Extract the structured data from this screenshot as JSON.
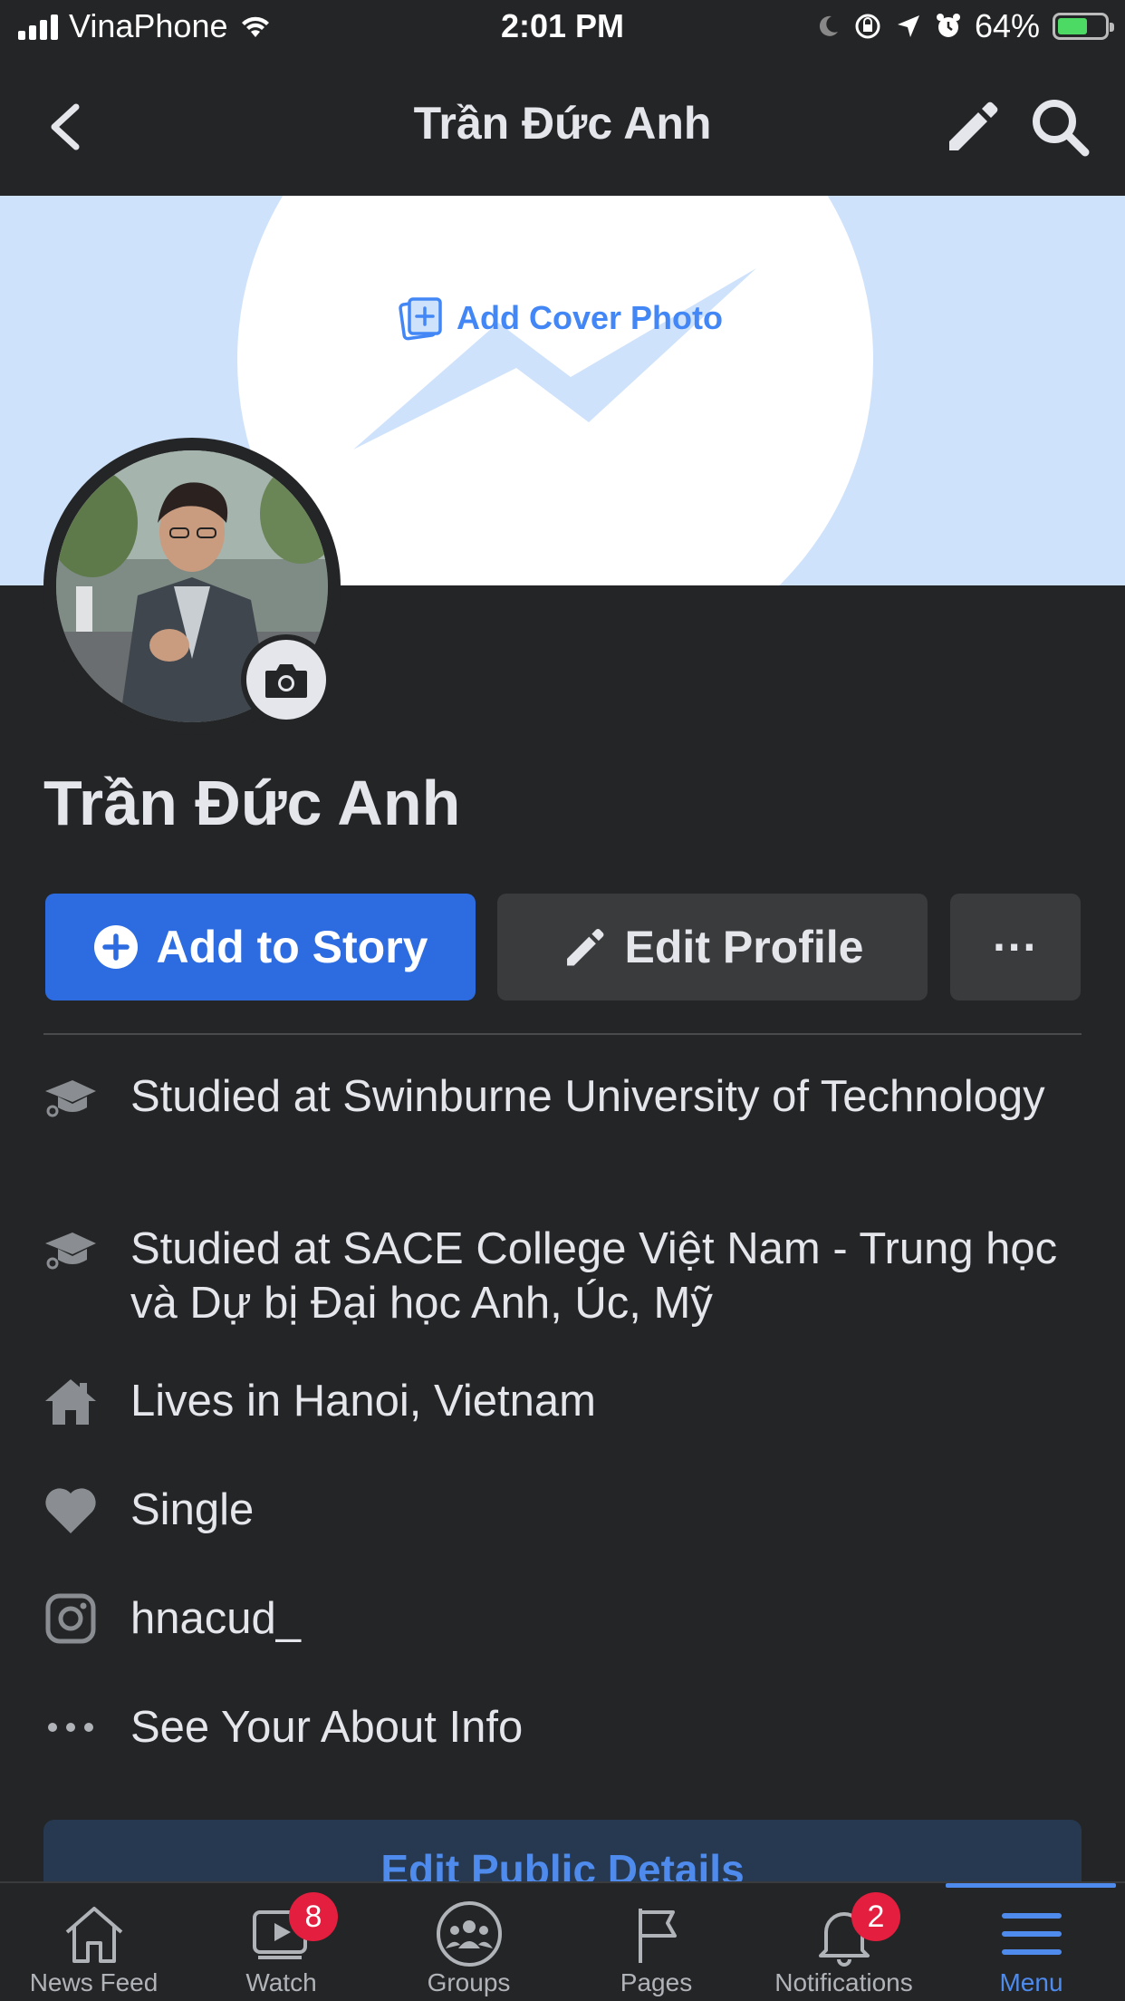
{
  "status_bar": {
    "carrier": "VinaPhone",
    "time": "2:01 PM",
    "battery_percent": "64%",
    "battery_level": 0.64
  },
  "nav": {
    "title": "Trần Đức Anh"
  },
  "cover": {
    "add_cover_label": "Add Cover Photo"
  },
  "profile": {
    "name": "Trần Đức Anh"
  },
  "actions": {
    "add_story_label": "Add to Story",
    "edit_profile_label": "Edit Profile",
    "more_label": "···"
  },
  "info": [
    {
      "icon": "graduation-cap-icon",
      "prefix": "Studied at ",
      "value": "Swinburne University of Technology"
    },
    {
      "icon": "graduation-cap-icon",
      "prefix": "Studied at ",
      "value": "SACE College Việt Nam - Trung học và Dự bị Đại học Anh, Úc, Mỹ"
    },
    {
      "icon": "home-icon",
      "prefix": "Lives in ",
      "value": "Hanoi, Vietnam"
    },
    {
      "icon": "heart-icon",
      "prefix": "",
      "value": "Single"
    },
    {
      "icon": "instagram-icon",
      "prefix": "",
      "value": "hnacud_"
    },
    {
      "icon": "more-dots-icon",
      "prefix": "",
      "value": "See Your About Info"
    }
  ],
  "edit_public_details_label": "Edit Public Details",
  "tabs": [
    {
      "label": "News Feed",
      "icon": "home-icon",
      "badge": ""
    },
    {
      "label": "Watch",
      "icon": "video-icon",
      "badge": "8"
    },
    {
      "label": "Groups",
      "icon": "groups-icon",
      "badge": ""
    },
    {
      "label": "Pages",
      "icon": "flag-icon",
      "badge": ""
    },
    {
      "label": "Notifications",
      "icon": "bell-icon",
      "badge": "2"
    },
    {
      "label": "Menu",
      "icon": "menu-icon",
      "badge": "",
      "active": true
    }
  ],
  "colors": {
    "background": "#242526",
    "accent": "#2d6ce0",
    "badge": "#e41e3f",
    "cover": "#cfe2fb"
  }
}
